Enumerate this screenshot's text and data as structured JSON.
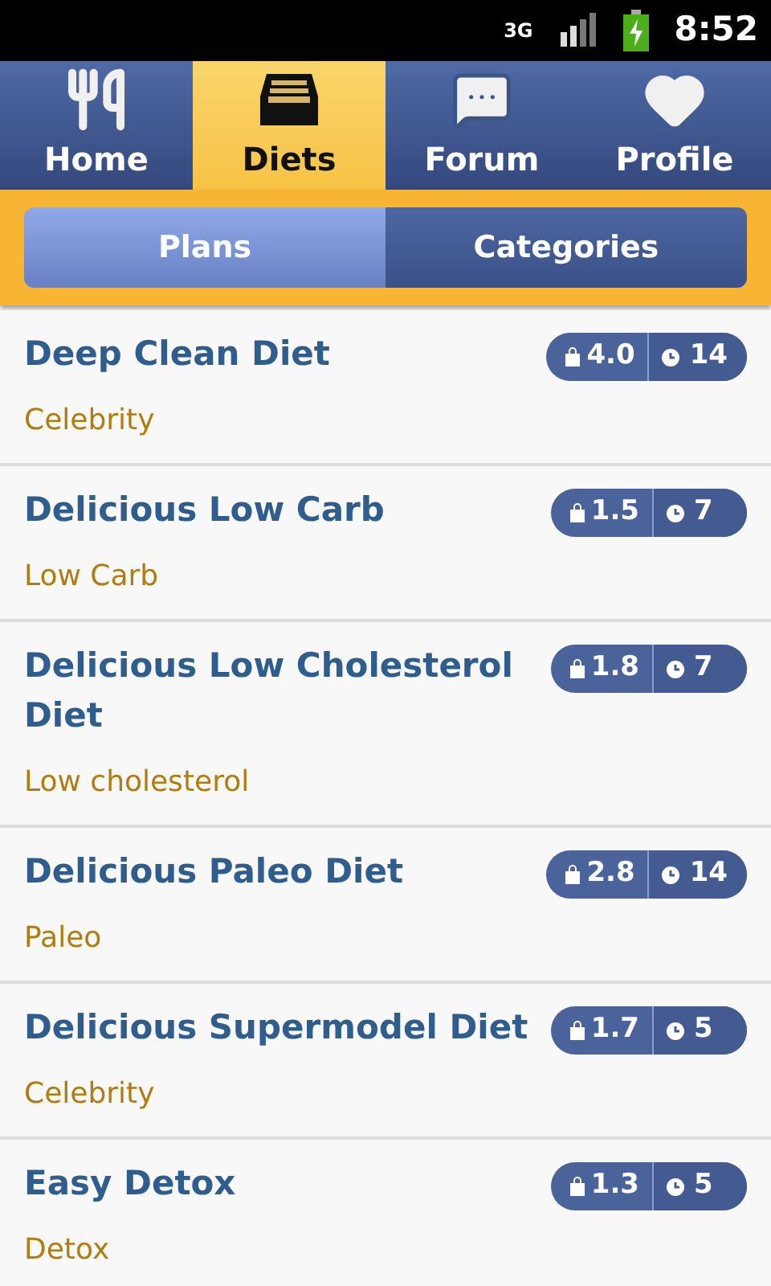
{
  "status_bar": {
    "network": "3G",
    "time": "8:52"
  },
  "tabs": [
    {
      "label": "Home",
      "kind": "utensils",
      "selected": false
    },
    {
      "label": "Diets",
      "kind": "tray",
      "selected": true
    },
    {
      "label": "Forum",
      "kind": "chat",
      "selected": false
    },
    {
      "label": "Profile",
      "kind": "heart",
      "selected": false
    }
  ],
  "segments": [
    {
      "label": "Plans",
      "selected": true
    },
    {
      "label": "Categories",
      "selected": false
    }
  ],
  "diets": [
    {
      "name": "Deep Clean Diet",
      "category": "Celebrity",
      "cost": "4.0",
      "days": "14"
    },
    {
      "name": "Delicious Low Carb",
      "category": "Low Carb",
      "cost": "1.5",
      "days": "7"
    },
    {
      "name": "Delicious Low Cholesterol Diet",
      "category": "Low cholesterol",
      "cost": "1.8",
      "days": "7"
    },
    {
      "name": "Delicious Paleo Diet",
      "category": "Paleo",
      "cost": "2.8",
      "days": "14"
    },
    {
      "name": "Delicious Supermodel Diet",
      "category": "Celebrity",
      "cost": "1.7",
      "days": "5"
    },
    {
      "name": "Easy Detox",
      "category": "Detox",
      "cost": "1.3",
      "days": "5"
    }
  ]
}
